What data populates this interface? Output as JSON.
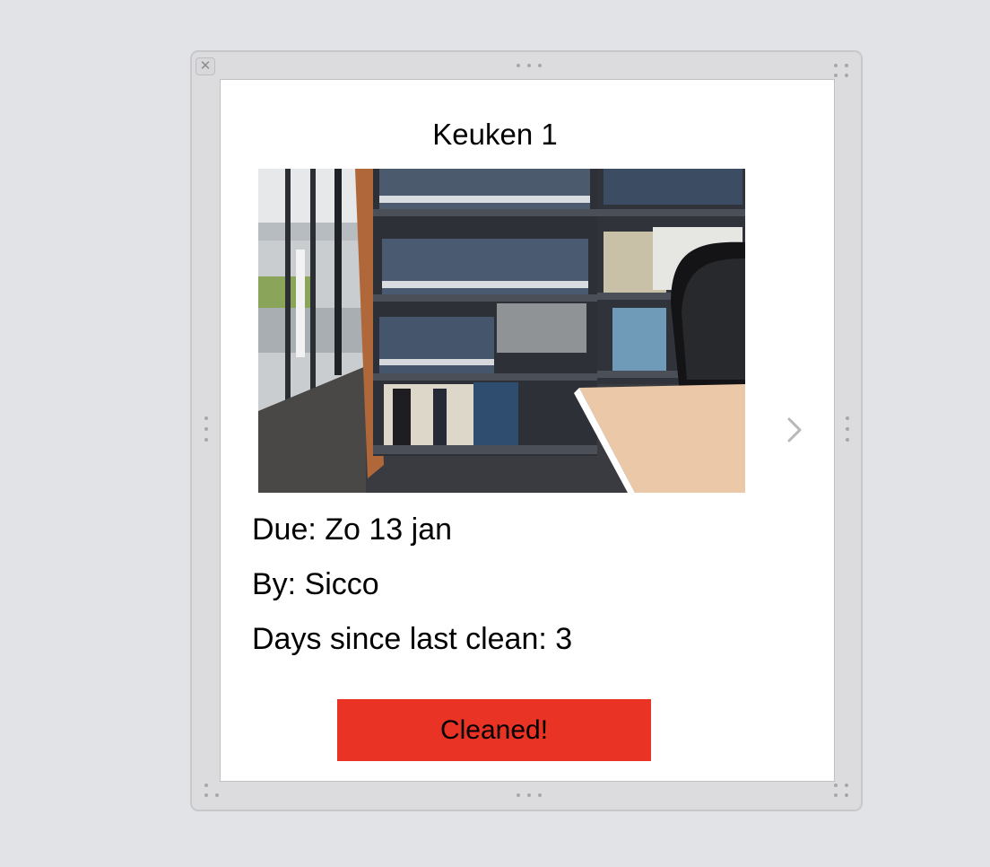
{
  "card": {
    "title": "Keuken 1",
    "due": "Due: Zo 13 jan",
    "by": "By: Sicco",
    "days_since": "Days since last clean: 3",
    "button_label": "Cleaned!"
  },
  "colors": {
    "background": "#e2e3e6",
    "button": "#e83325"
  },
  "icons": {
    "close": "close-icon",
    "next": "chevron-right-icon"
  },
  "close_glyph": "✕"
}
